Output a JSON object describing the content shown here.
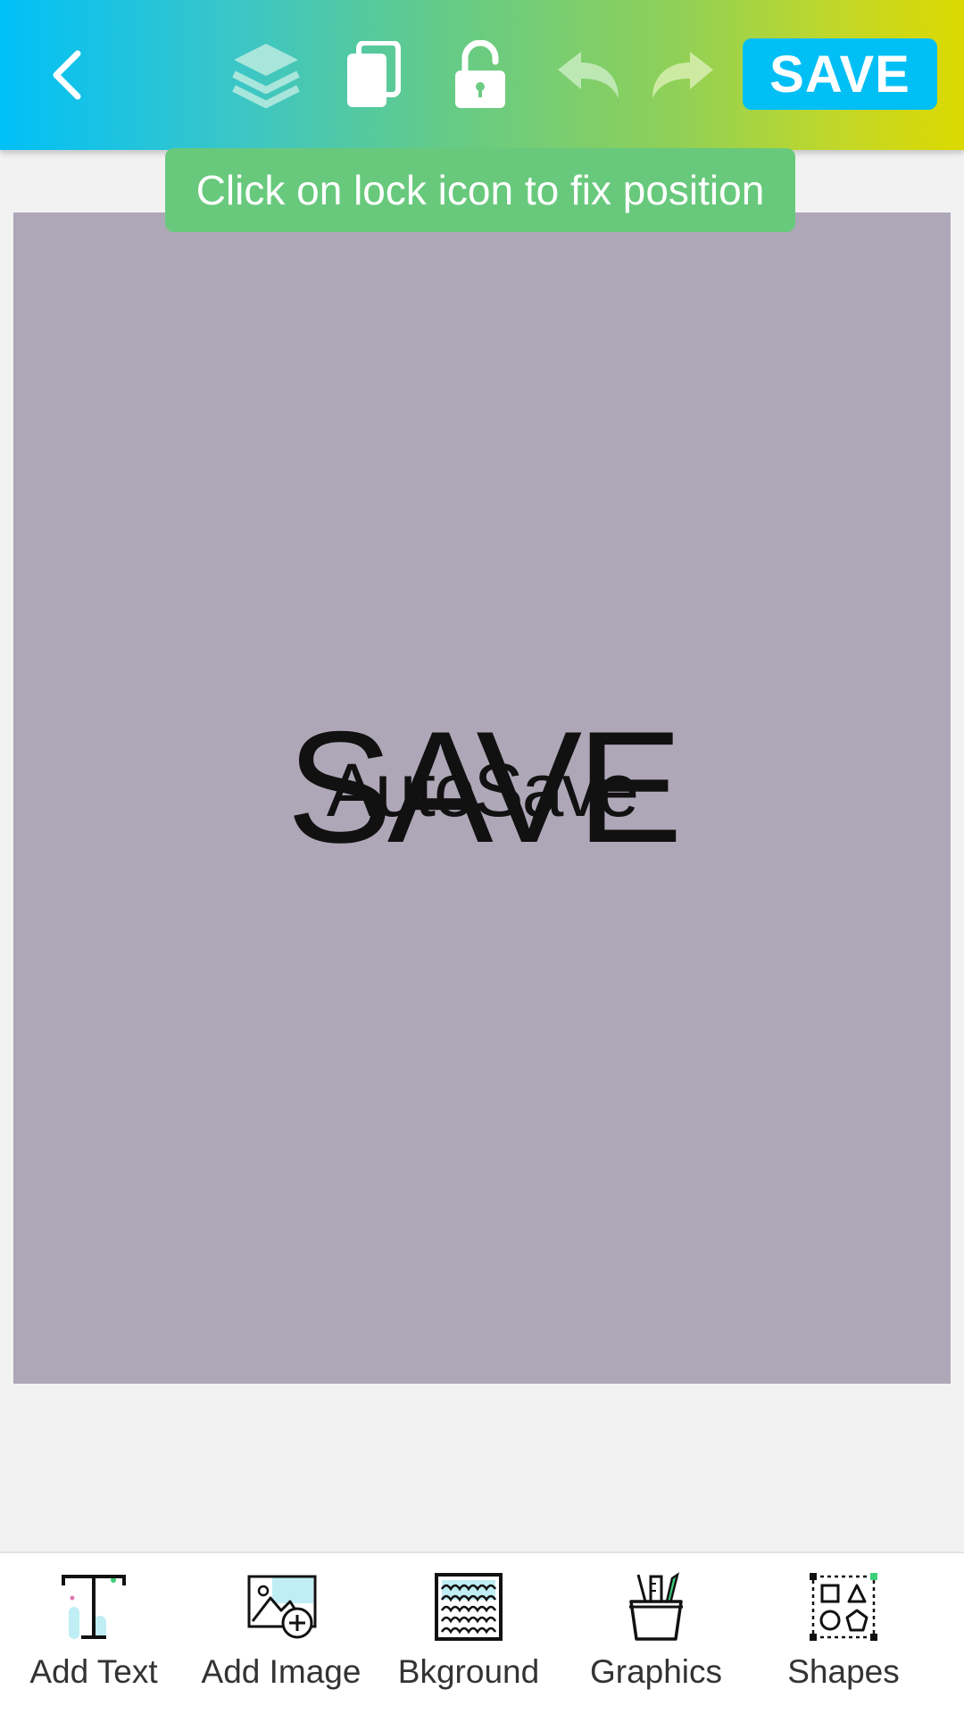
{
  "toolbar": {
    "save_label": "SAVE",
    "icons": [
      "back-icon",
      "layers-icon",
      "copy-icon",
      "unlock-icon",
      "undo-icon",
      "redo-icon"
    ]
  },
  "tooltip": {
    "text": "Click on lock icon to fix position"
  },
  "canvas": {
    "background": "#aea7b7",
    "texts": [
      "SAVE",
      "AutoSave"
    ]
  },
  "bottom_bar": {
    "tools": [
      {
        "label": "Add Text",
        "icon": "add-text-icon"
      },
      {
        "label": "Add Image",
        "icon": "add-image-icon"
      },
      {
        "label": "Bkground",
        "icon": "background-icon"
      },
      {
        "label": "Graphics",
        "icon": "graphics-icon"
      },
      {
        "label": "Shapes",
        "icon": "shapes-icon"
      }
    ]
  },
  "colors": {
    "accent": "#00bff5",
    "tooltip": "#68c97c"
  }
}
